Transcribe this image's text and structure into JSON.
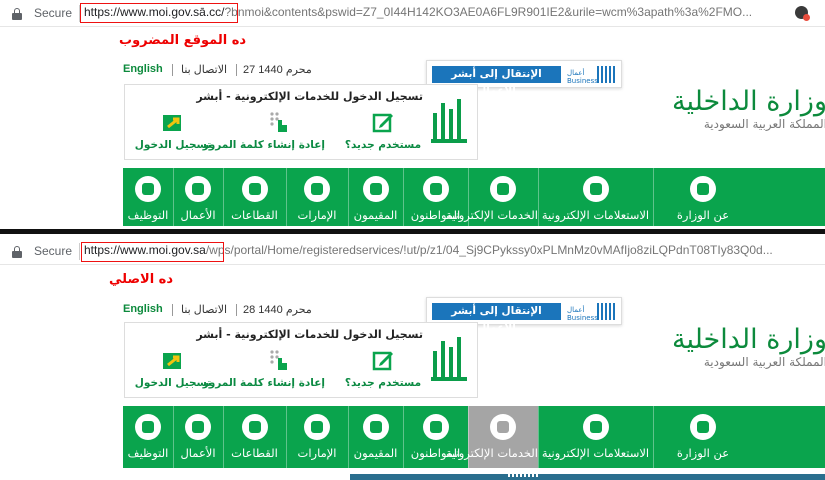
{
  "shots": [
    {
      "browser": {
        "secure_label": "Secure",
        "url_host": "https://www.moi.gov.sā.cc/",
        "url_path": "?bnmoi&contents&pswid=Z7_0I44H142KO3AE0A6FL9R901IE2&urile=wcm%3apath%3a%2FMO..."
      },
      "caption": "ده الموقع المضروب",
      "header": {
        "english_link": "English",
        "contact_link": "الاتصال بنا",
        "date": "27 محرم 1440",
        "absher_business_button": "الإنتقال إلى أبشر الأعمال",
        "absher_business_logo_text": "أعمال Business"
      },
      "login": {
        "title": "تسجيل الدخول للخدمات الإلكترونية - أبشر",
        "options": [
          {
            "label": "مستخدم جديد؟",
            "icon": "edit-icon"
          },
          {
            "label": "إعادة إنشاء كلمة المرور",
            "icon": "password-reset-icon"
          },
          {
            "label": "تسجيل الدخول",
            "icon": "login-icon"
          }
        ]
      },
      "ministry": {
        "name": "وزارة الداخلية",
        "subtitle": "المملكة العربية السعودية"
      },
      "nav": {
        "items": [
          {
            "label": "التوظيف",
            "icon": "jobs-icon"
          },
          {
            "label": "الأعمال",
            "icon": "business-icon"
          },
          {
            "label": "القطاعات",
            "icon": "sectors-icon"
          },
          {
            "label": "الإمارات",
            "icon": "emirates-icon"
          },
          {
            "label": "المقيمون",
            "icon": "residents-icon"
          },
          {
            "label": "المواطنون",
            "icon": "citizens-icon"
          },
          {
            "label": "الخدمات الإلكترونية",
            "icon": "eservices-icon"
          },
          {
            "label": "الاستعلامات الإلكترونية",
            "icon": "einquiries-icon"
          },
          {
            "label": "عن الوزارة",
            "icon": "about-ministry-icon"
          }
        ],
        "active_index": -1
      }
    },
    {
      "browser": {
        "secure_label": "Secure",
        "url_host": "https://www.moi.gov.sa",
        "url_path": "/wps/portal/Home/registeredservices/!ut/p/z1/04_Sj9CPykssy0xPLMnMz0vMAfIjo8ziLQPdnT08TIy83Q0d..."
      },
      "caption": "ده الاصلي",
      "header": {
        "english_link": "English",
        "contact_link": "الاتصال بنا",
        "date": "28 محرم 1440",
        "absher_business_button": "الإنتقال إلى أبشر الأعمال",
        "absher_business_logo_text": "أعمال Business"
      },
      "login": {
        "title": "تسجيل الدخول للخدمات الإلكترونية - أبشر",
        "options": [
          {
            "label": "مستخدم جديد؟",
            "icon": "edit-icon"
          },
          {
            "label": "إعادة إنشاء كلمة المرور",
            "icon": "password-reset-icon"
          },
          {
            "label": "تسجيل الدخول",
            "icon": "login-icon"
          }
        ]
      },
      "ministry": {
        "name": "وزارة الداخلية",
        "subtitle": "المملكة العربية السعودية"
      },
      "nav": {
        "items": [
          {
            "label": "التوظيف",
            "icon": "jobs-icon"
          },
          {
            "label": "الأعمال",
            "icon": "business-icon"
          },
          {
            "label": "القطاعات",
            "icon": "sectors-icon"
          },
          {
            "label": "الإمارات",
            "icon": "emirates-icon"
          },
          {
            "label": "المقيمون",
            "icon": "residents-icon"
          },
          {
            "label": "المواطنون",
            "icon": "citizens-icon"
          },
          {
            "label": "الخدمات الإلكترونية",
            "icon": "eservices-icon"
          },
          {
            "label": "الاستعلامات الإلكترونية",
            "icon": "einquiries-icon"
          },
          {
            "label": "عن الوزارة",
            "icon": "about-ministry-icon"
          }
        ],
        "active_index": 6
      }
    }
  ],
  "colors": {
    "brand_green": "#0aa44d",
    "absher_blue": "#1b75bb",
    "annotation_red": "#e11111",
    "active_tab_gray": "#a5a5a5"
  }
}
